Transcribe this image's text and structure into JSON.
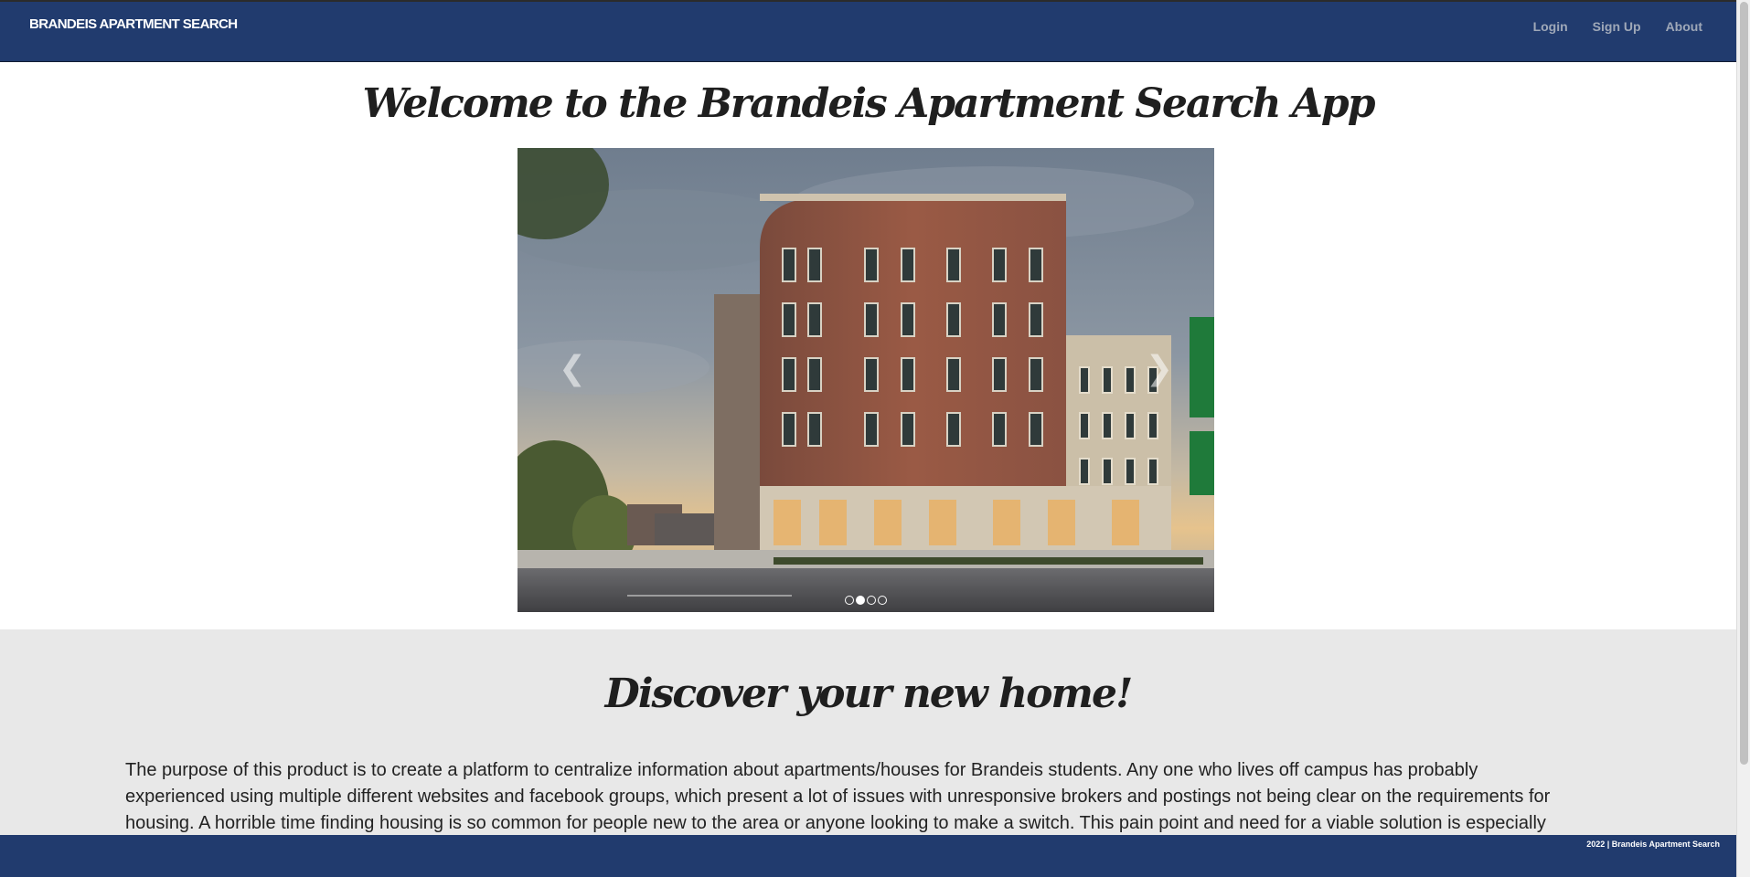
{
  "navbar": {
    "brand": "BRANDEIS APARTMENT SEARCH",
    "links": [
      "Login",
      "Sign Up",
      "About"
    ]
  },
  "hero": {
    "title": "Welcome to the Brandeis Apartment Search App"
  },
  "carousel": {
    "slide_count": 4,
    "active_index": 1,
    "image_subject": "red brick apartment building at dusk"
  },
  "discover": {
    "title": "Discover your new home!",
    "text": "The purpose of this product is to create a platform to centralize information about apartments/houses for Brandeis students. Any one who lives off campus has probably experienced using multiple different websites and facebook groups, which present a lot of issues with unresponsive brokers and postings not being clear on the requirements for housing. A horrible time finding housing is so common for people new to the area or anyone looking to make a switch. This pain point and need for a viable solution is especially evident now that it’s even harder for"
  },
  "footer": {
    "text": "2022 | Brandeis Apartment Search"
  },
  "colors": {
    "navbar_bg": "#213b6e",
    "page_bg": "#e8e8e8"
  }
}
